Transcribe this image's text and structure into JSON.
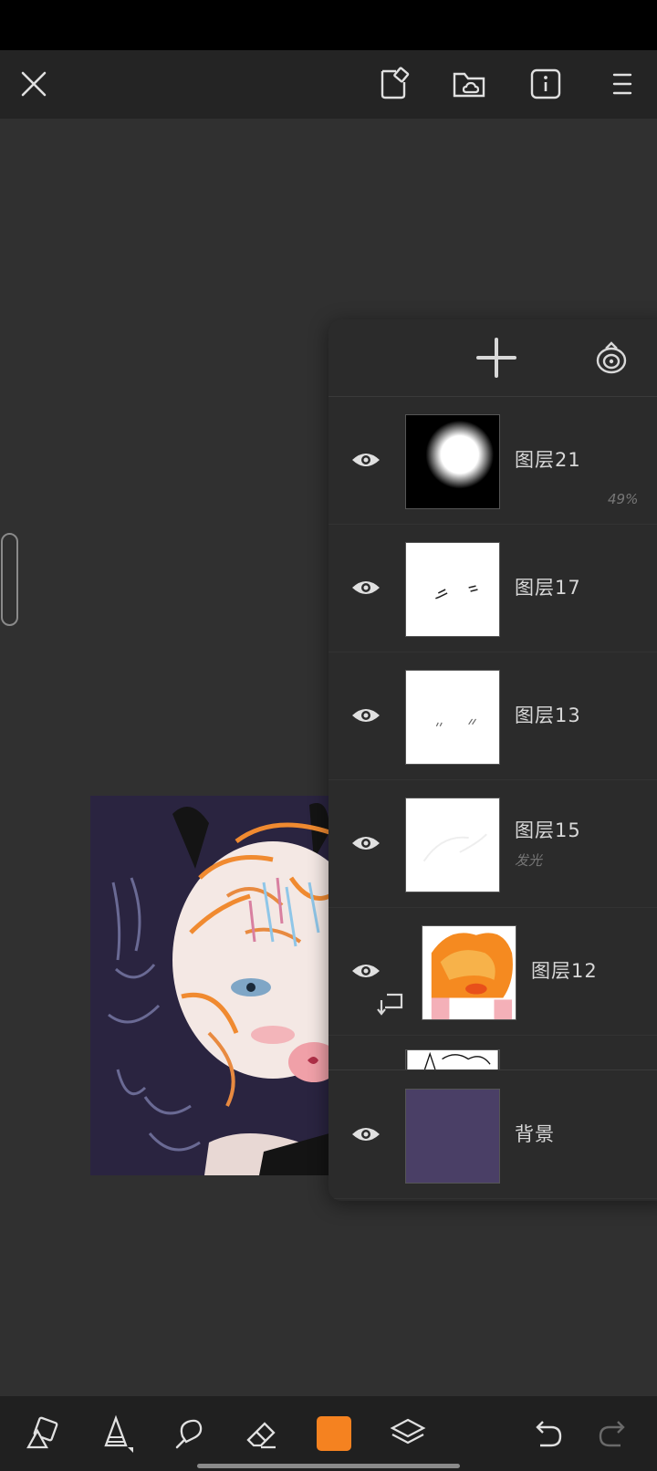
{
  "colors": {
    "accent": "#F58220",
    "background_layer": "#4A3F66",
    "canvas_bg": "#2a2440"
  },
  "top_bar": {
    "icons": [
      "close-icon",
      "canvas-settings-icon",
      "cloud-folder-icon",
      "info-icon",
      "menu-icon"
    ]
  },
  "layers_panel": {
    "header_icons": [
      "add-layer-icon",
      "reference-icon"
    ],
    "layers": [
      {
        "name": "图层21",
        "opacity": "49%",
        "visible": true
      },
      {
        "name": "图层17",
        "visible": true
      },
      {
        "name": "图层13",
        "visible": true
      },
      {
        "name": "图层15",
        "blend": "发光",
        "visible": true
      },
      {
        "name": "图层12",
        "visible": true,
        "clipping": true
      },
      {
        "name": "背景",
        "visible": true
      }
    ]
  },
  "bottom_bar": {
    "tools": [
      "shape-icon",
      "brush-icon",
      "smudge-icon",
      "eraser-icon",
      "color-swatch",
      "layers-icon",
      "undo-icon",
      "redo-icon"
    ],
    "active_color": "#F58220"
  }
}
